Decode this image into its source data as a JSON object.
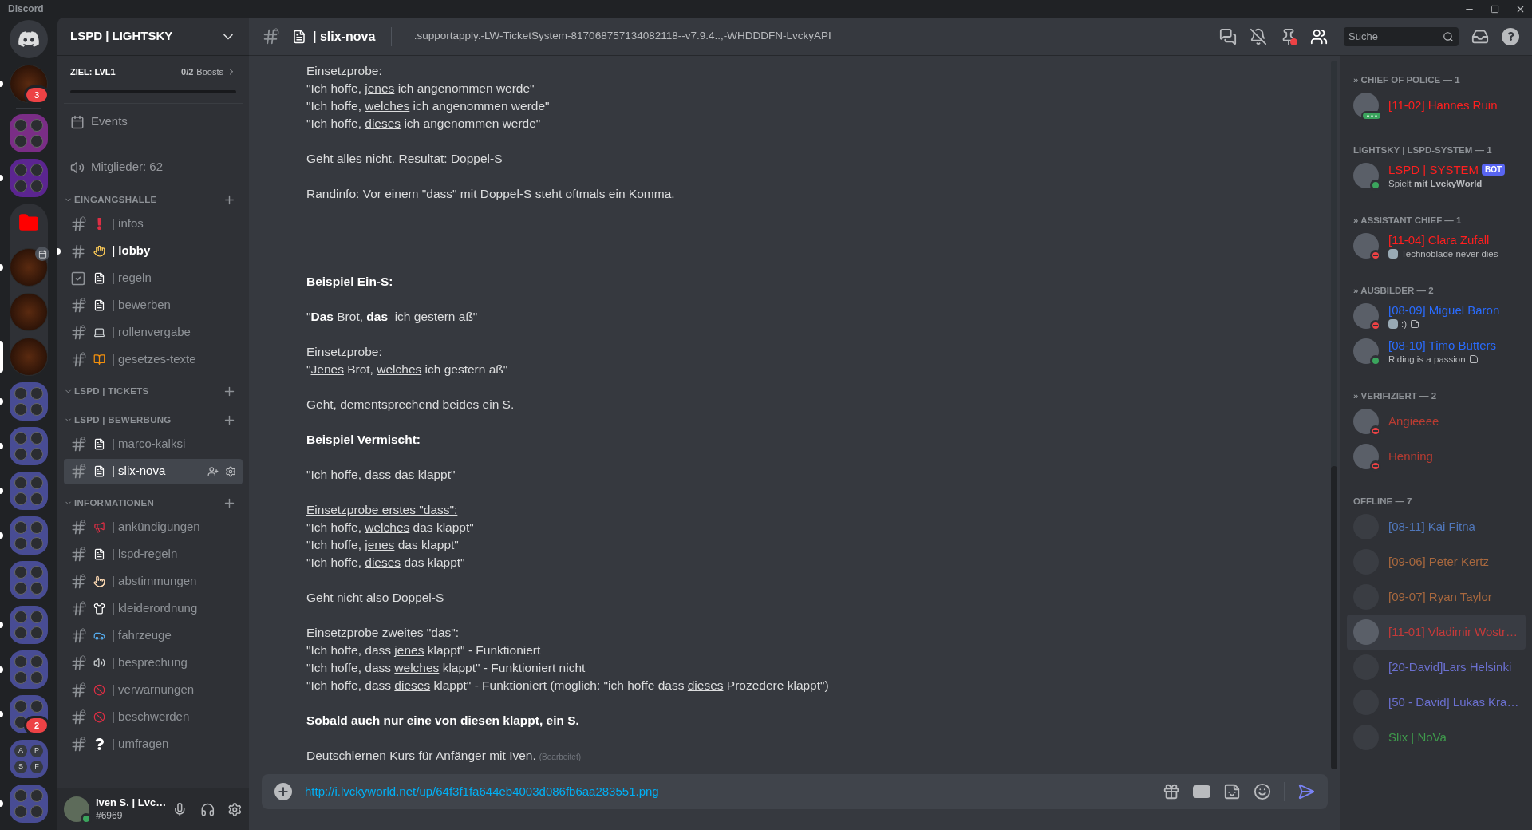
{
  "app_title": "Discord",
  "servers": [
    {
      "kind": "home",
      "unread": false,
      "selected": false
    },
    {
      "kind": "server",
      "unread": true,
      "selected": false,
      "badge": "3",
      "event": false
    },
    {
      "kind": "divider"
    },
    {
      "kind": "folder",
      "color": "#7a2d86",
      "unread": false,
      "selected": false
    },
    {
      "kind": "folder",
      "color": "#5b2590",
      "unread": true,
      "selected": false
    },
    {
      "kind": "open-folder",
      "color": "#ff0000",
      "children": [
        {
          "kind": "server",
          "unread": true,
          "selected": false,
          "event": true
        },
        {
          "kind": "server",
          "unread": false,
          "selected": false,
          "event": false
        },
        {
          "kind": "server",
          "unread": false,
          "selected": true,
          "event": false
        }
      ]
    },
    {
      "kind": "folder",
      "color": "#484c94",
      "unread": true,
      "selected": false
    },
    {
      "kind": "folder",
      "color": "#484c94",
      "unread": true,
      "selected": false
    },
    {
      "kind": "folder",
      "color": "#484c94",
      "unread": true,
      "selected": false
    },
    {
      "kind": "folder",
      "color": "#484c94",
      "unread": true,
      "selected": false
    },
    {
      "kind": "folder",
      "color": "#484c94",
      "unread": false,
      "selected": false
    },
    {
      "kind": "folder",
      "color": "#484c94",
      "unread": true,
      "selected": false
    },
    {
      "kind": "folder",
      "color": "#484c94",
      "unread": true,
      "selected": false
    },
    {
      "kind": "folder",
      "color": "#484c94",
      "unread": true,
      "selected": false,
      "badge": "2"
    },
    {
      "kind": "folder",
      "color": "#484c94",
      "unread": false,
      "selected": false,
      "letters": [
        "A",
        "P",
        "S",
        "F"
      ]
    },
    {
      "kind": "folder",
      "color": "#484c94",
      "unread": true,
      "selected": false
    }
  ],
  "guild": {
    "name": "LSPD | LIGHTSKY",
    "goal": "ZIEL: LVL1",
    "boosts": "0/2",
    "boosts_label": "Boosts",
    "level": 0,
    "events": "Events",
    "members": "Mitglieder: 62"
  },
  "categories": [
    {
      "name": "EINGANGSHALLE",
      "expanded": true,
      "channels": [
        {
          "name": "| infos",
          "kind": "locked",
          "selected": false,
          "unread": false
        },
        {
          "name": "| lobby",
          "kind": "text",
          "selected": false,
          "unread": true
        },
        {
          "name": "| regeln",
          "kind": "rules",
          "selected": false,
          "unread": false
        },
        {
          "name": "| bewerben",
          "kind": "locked",
          "selected": false,
          "unread": false
        },
        {
          "name": "| rollenvergabe",
          "kind": "locked",
          "selected": false,
          "unread": false
        },
        {
          "name": "| gesetzes-texte",
          "kind": "locked",
          "selected": false,
          "unread": false
        }
      ]
    },
    {
      "name": "LSPD | TICKETS",
      "expanded": true
    },
    {
      "name": "LSPD | BEWERBUNG",
      "expanded": true,
      "channels": [
        {
          "name": "| marco-kalksi",
          "kind": "locked",
          "selected": false,
          "unread": false
        },
        {
          "name": "| slix-nova",
          "kind": "locked",
          "selected": true,
          "unread": false
        }
      ]
    },
    {
      "name": "INFORMATIONEN",
      "expanded": true,
      "channels": [
        {
          "name": "| ankündigungen",
          "kind": "locked",
          "selected": false,
          "unread": false
        },
        {
          "name": "| lspd-regeln",
          "kind": "locked",
          "selected": false,
          "unread": false
        },
        {
          "name": "| abstimmungen",
          "kind": "locked",
          "selected": false,
          "unread": false
        },
        {
          "name": "| kleiderordnung",
          "kind": "locked",
          "selected": false,
          "unread": false
        },
        {
          "name": "| fahrzeuge",
          "kind": "locked",
          "selected": false,
          "unread": false
        },
        {
          "name": "| besprechung",
          "kind": "locked",
          "selected": false,
          "unread": false
        },
        {
          "name": "| verwarnungen",
          "kind": "locked",
          "selected": false,
          "unread": false
        },
        {
          "name": "| beschwerden",
          "kind": "locked",
          "selected": false,
          "unread": false
        },
        {
          "name": "| umfragen",
          "kind": "locked",
          "selected": false,
          "unread": false
        }
      ]
    }
  ],
  "user": {
    "name": "Iven S. | Lvc…",
    "tag": "#6969",
    "kind": "online"
  },
  "header": {
    "channel": "| slix-nova",
    "topic": "_.supportapply.-LW-TicketSystem-817068757134082118--v7.9.4..,-WHDDDFN-LvckyAPI_",
    "search_placeholder": "Suche",
    "members_open": true,
    "pin_alert": true
  },
  "messages": [
    {
      "lines": [
        [
          {
            "text": "Einsetzprobe:",
            "kind": "plain"
          }
        ],
        [
          {
            "text": "\"Ich hoffe, ",
            "kind": "plain"
          },
          {
            "text": "jenes",
            "kind": "underline"
          },
          {
            "text": " ich angenommen werde\"",
            "kind": "plain"
          }
        ],
        [
          {
            "text": "\"Ich hoffe, ",
            "kind": "plain"
          },
          {
            "text": "welches",
            "kind": "underline"
          },
          {
            "text": " ich angenommen werde\"",
            "kind": "plain"
          }
        ],
        [
          {
            "text": "\"Ich hoffe, ",
            "kind": "plain"
          },
          {
            "text": "dieses",
            "kind": "underline"
          },
          {
            "text": " ich angenommen werde\"",
            "kind": "plain"
          }
        ]
      ]
    },
    {
      "lines": [
        [
          {
            "text": "Geht alles nicht. Resultat: Doppel-S",
            "kind": "plain"
          }
        ]
      ]
    },
    {
      "lines": [
        [
          {
            "text": "Randinfo: Vor einem \"dass\" mit Doppel-S steht oftmals ein Komma.",
            "kind": "plain"
          }
        ]
      ]
    },
    {
      "lines": [
        [
          {
            "text": "Beispiel Ein-S:",
            "kind": "bold-underline"
          }
        ]
      ]
    },
    {
      "lines": [
        [
          {
            "text": "\"",
            "kind": "plain"
          },
          {
            "text": "Das",
            "kind": "bold"
          },
          {
            "text": " Brot, ",
            "kind": "plain"
          },
          {
            "text": "das",
            "kind": "bold"
          },
          {
            "text": "  ich gestern aß\"",
            "kind": "plain"
          }
        ]
      ]
    },
    {
      "lines": [
        [
          {
            "text": "Einsetzprobe:",
            "kind": "plain"
          }
        ],
        [
          {
            "text": "\"",
            "kind": "plain"
          },
          {
            "text": "Jenes",
            "kind": "underline"
          },
          {
            "text": " Brot, ",
            "kind": "plain"
          },
          {
            "text": "welches",
            "kind": "underline"
          },
          {
            "text": " ich gestern aß\"",
            "kind": "plain"
          }
        ]
      ]
    },
    {
      "lines": [
        [
          {
            "text": "Geht, dementsprechend beides ein S.",
            "kind": "plain"
          }
        ]
      ]
    },
    {
      "lines": [
        [
          {
            "text": "Beispiel Vermischt:",
            "kind": "bold-underline"
          }
        ]
      ]
    },
    {
      "lines": [
        [
          {
            "text": "\"Ich hoffe, ",
            "kind": "plain"
          },
          {
            "text": "dass",
            "kind": "underline"
          },
          {
            "text": "das",
            "kind": "underline"
          },
          {
            "text": " klappt\"",
            "kind": "plain"
          }
        ]
      ]
    },
    {
      "lines": [
        [
          {
            "text": "Einsetzprobe erstes \"dass\":",
            "kind": "underline"
          }
        ],
        [
          {
            "text": "\"Ich hoffe, ",
            "kind": "plain"
          },
          {
            "text": "welches",
            "kind": "underline"
          },
          {
            "text": " das klappt\"",
            "kind": "plain"
          }
        ],
        [
          {
            "text": "\"Ich hoffe, ",
            "kind": "plain"
          },
          {
            "text": "jenes",
            "kind": "underline"
          },
          {
            "text": " das klappt\"",
            "kind": "plain"
          }
        ],
        [
          {
            "text": "\"Ich hoffe, ",
            "kind": "plain"
          },
          {
            "text": "dieses",
            "kind": "underline"
          },
          {
            "text": " das klappt\"",
            "kind": "plain"
          }
        ]
      ]
    },
    {
      "lines": [
        [
          {
            "text": "Geht nicht also Doppel-S",
            "kind": "plain"
          }
        ]
      ]
    },
    {
      "lines": [
        [
          {
            "text": "Einsetzprobe zweites \"das\":",
            "kind": "underline"
          }
        ],
        [
          {
            "text": "\"Ich hoffe, dass ",
            "kind": "plain"
          },
          {
            "text": "jenes",
            "kind": "underline"
          },
          {
            "text": " klappt\" - Funktioniert",
            "kind": "plain"
          }
        ],
        [
          {
            "text": "\"Ich hoffe, dass ",
            "kind": "plain"
          },
          {
            "text": "welches",
            "kind": "underline"
          },
          {
            "text": " klappt\" - Funktioniert nicht",
            "kind": "plain"
          }
        ],
        [
          {
            "text": "\"Ich hoffe, dass ",
            "kind": "plain"
          },
          {
            "text": "dieses",
            "kind": "underline"
          },
          {
            "text": " klappt\" - Funktioniert (möglich: \"ich hoffe dass ",
            "kind": "plain"
          },
          {
            "text": "dieses",
            "kind": "underline"
          },
          {
            "text": " Prozedere klappt\")",
            "kind": "plain"
          }
        ]
      ]
    },
    {
      "lines": [
        [
          {
            "text": "Sobald auch nur eine von diesen klappt, ein S.",
            "kind": "bold"
          }
        ]
      ]
    },
    {
      "lines": [
        [
          {
            "text": "Deutschlernen Kurs für Anfänger mit Iven.",
            "kind": "plain"
          },
          {
            "text": "(Bearbeitet)",
            "kind": "edited"
          }
        ]
      ]
    }
  ],
  "composer": {
    "value": "http://i.lvckyworld.net/up/64f3f1fa644eb4003d086fb6aa283551.png"
  },
  "member_groups": [
    {
      "title": "» CHIEF OF POLICE — 1",
      "members": [
        {
          "name": "[11-02] Hannes Ruin",
          "color": "#ff1f1f",
          "kind": "typing",
          "hovered": false
        }
      ]
    },
    {
      "title": "LIGHTSKY | LSPD-SYSTEM — 1",
      "members": [
        {
          "name": "LSPD | SYSTEM",
          "color": "#ff1f1f",
          "kind": "online",
          "hovered": false,
          "tag": "BOT",
          "activity": {
            "text": "Spielt **mit LvckyWorld**",
            "emoji": false,
            "note": false
          }
        }
      ]
    },
    {
      "title": "» ASSISTANT CHIEF — 1",
      "members": [
        {
          "name": "[11-04] Clara Zufall",
          "color": "#ff1f1f",
          "kind": "dnd",
          "hovered": false,
          "activity": {
            "text": "Technoblade never dies",
            "emoji": true,
            "note": false
          }
        }
      ]
    },
    {
      "title": "» AUSBILDER — 2",
      "members": [
        {
          "name": "[08-09] Miguel Baron",
          "color": "#2a6cff",
          "kind": "dnd",
          "hovered": false,
          "activity": {
            "text": ":)",
            "emoji": true,
            "note": true
          }
        },
        {
          "name": "[08-10] Timo Butters",
          "color": "#2a6cff",
          "kind": "online",
          "hovered": false,
          "activity": {
            "text": "Riding is a passion",
            "emoji": false,
            "note": true
          }
        }
      ]
    },
    {
      "title": "» VERIFIZIERT — 2",
      "members": [
        {
          "name": "Angieeee",
          "color": "#b83c32",
          "kind": "dnd",
          "hovered": false
        },
        {
          "name": "Henning",
          "color": "#b83c32",
          "kind": "dnd",
          "hovered": false
        }
      ]
    },
    {
      "title": "OFFLINE — 7",
      "members": [
        {
          "name": "[08-11] Kai Fitna",
          "color": "#5077bb",
          "kind": "offline",
          "hovered": false
        },
        {
          "name": "[09-06] Peter Kertz",
          "color": "#a8683e",
          "kind": "offline",
          "hovered": false
        },
        {
          "name": "[09-07] Ryan Taylor",
          "color": "#a8683e",
          "kind": "offline",
          "hovered": false
        },
        {
          "name": "[11-01] Vladimir Wostr…",
          "color": "#c43a3a",
          "kind": "offline",
          "hovered": true
        },
        {
          "name": "[20-David]Lars Helsinki",
          "color": "#6b70d0",
          "kind": "offline",
          "hovered": false
        },
        {
          "name": "[50 - David] Lukas Kra…",
          "color": "#6b70d0",
          "kind": "offline",
          "hovered": false
        },
        {
          "name": "Slix | NoVa",
          "color": "#3f9a4c",
          "kind": "offline",
          "hovered": false
        }
      ]
    }
  ]
}
